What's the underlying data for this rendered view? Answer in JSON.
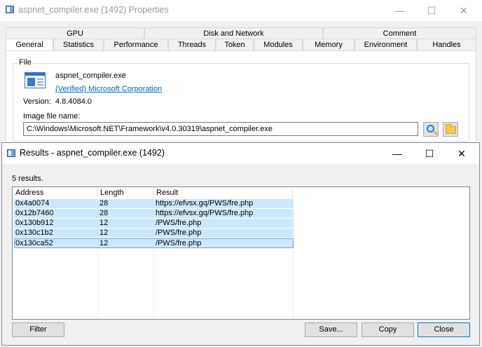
{
  "props": {
    "title": "aspnet_compiler.exe (1492) Properties",
    "tabs_top": [
      "GPU",
      "Disk and Network",
      "Comment"
    ],
    "tabs_bottom": [
      "General",
      "Statistics",
      "Performance",
      "Threads",
      "Token",
      "Modules",
      "Memory",
      "Environment",
      "Handles"
    ],
    "file_group_label": "File",
    "file_name": "aspnet_compiler.exe",
    "verified_link": "(Verified) Microsoft Corporation",
    "version_label": "Version:",
    "version_value": "4.8.4084.0",
    "image_file_label": "Image file name:",
    "image_path": "C:\\Windows\\Microsoft.NET\\Framework\\v4.0.30319\\aspnet_compiler.exe"
  },
  "results": {
    "title": "Results - aspnet_compiler.exe (1492)",
    "count": "5 results.",
    "columns": [
      "Address",
      "Length",
      "Result"
    ],
    "rows": [
      {
        "address": "0x4a0074",
        "length": "28",
        "result": "https://efvsx.gq/PWS/fre.php"
      },
      {
        "address": "0x12b7460",
        "length": "28",
        "result": "https://efvsx.gq/PWS/fre.php"
      },
      {
        "address": "0x130b912",
        "length": "12",
        "result": "/PWS/fre.php"
      },
      {
        "address": "0x130c1b2",
        "length": "12",
        "result": "/PWS/fre.php"
      },
      {
        "address": "0x130ca52",
        "length": "12",
        "result": "/PWS/fre.php"
      }
    ],
    "buttons": {
      "filter": "Filter",
      "save": "Save...",
      "copy": "Copy",
      "close": "Close"
    }
  },
  "window_controls": {
    "minimize": "—",
    "maximize": "☐",
    "close": "✕"
  },
  "icons": {
    "app": "window-app-icon",
    "file": "executable-file-icon",
    "search": "search-icon",
    "folder": "folder-icon"
  },
  "colors": {
    "selection": "#cce8ff",
    "link": "#0066cc",
    "focus_border": "#0078d7"
  }
}
